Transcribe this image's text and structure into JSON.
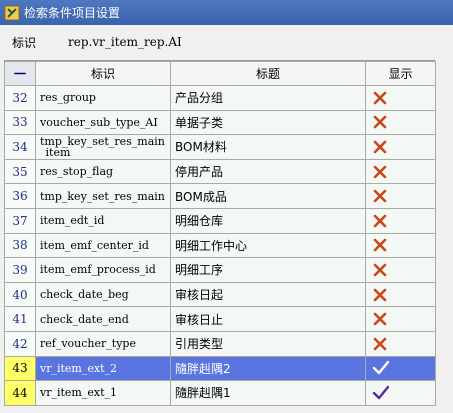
{
  "window": {
    "title": "检索条件项目设置"
  },
  "id_row": {
    "label": "标识",
    "value": "rep.vr_item_rep.AI"
  },
  "grid": {
    "corner": "一",
    "columns": [
      "标识",
      "标题",
      "显示"
    ],
    "rows": [
      {
        "num": "32",
        "field": "res_group",
        "title": "产品分组",
        "show": "x"
      },
      {
        "num": "33",
        "field": "voucher_sub_type_AI",
        "title": "单据子类",
        "show": "x"
      },
      {
        "num": "34",
        "field": "tmp_key_set_res_main_item",
        "title": "BOM材料",
        "show": "x"
      },
      {
        "num": "35",
        "field": "res_stop_flag",
        "title": "停用产品",
        "show": "x"
      },
      {
        "num": "36",
        "field": "tmp_key_set_res_main",
        "title": "BOM成品",
        "show": "x"
      },
      {
        "num": "37",
        "field": "item_edt_id",
        "title": "明细仓库",
        "show": "x"
      },
      {
        "num": "38",
        "field": "item_emf_center_id",
        "title": "明细工作中心",
        "show": "x"
      },
      {
        "num": "39",
        "field": "item_emf_process_id",
        "title": "明细工序",
        "show": "x"
      },
      {
        "num": "40",
        "field": "check_date_beg",
        "title": "审核日起",
        "show": "x"
      },
      {
        "num": "41",
        "field": "check_date_end",
        "title": "审核日止",
        "show": "x"
      },
      {
        "num": "42",
        "field": "ref_voucher_type",
        "title": "引用类型",
        "show": "x"
      },
      {
        "num": "43",
        "field": "vr_item_ext_2",
        "title": "隨胖赳隅2",
        "show": "check"
      },
      {
        "num": "44",
        "field": "vr_item_ext_1",
        "title": "隨胖赳隅1",
        "show": "check"
      }
    ]
  }
}
